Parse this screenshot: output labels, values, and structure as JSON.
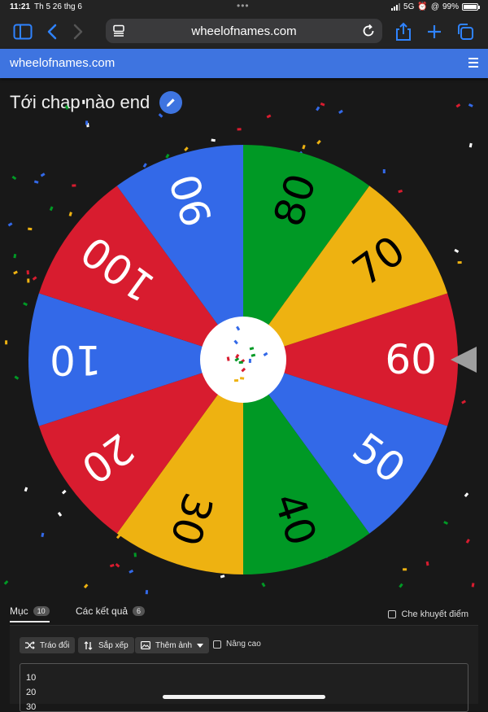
{
  "status_bar": {
    "time": "11:21",
    "date": "Th 5 26 thg 6",
    "network": "5G",
    "battery": "99%"
  },
  "browser": {
    "url": "wheelofnames.com"
  },
  "site": {
    "logo": "wheelofnames.com"
  },
  "wheel": {
    "title": "Tới chap nào end",
    "segments": [
      {
        "label": "60",
        "color": "#d81c2f"
      },
      {
        "label": "50",
        "color": "#3369e8"
      },
      {
        "label": "40",
        "color": "#009925"
      },
      {
        "label": "30",
        "color": "#eeb211"
      },
      {
        "label": "20",
        "color": "#d81c2f"
      },
      {
        "label": "10",
        "color": "#3369e8"
      },
      {
        "label": "100",
        "color": "#d81c2f"
      },
      {
        "label": "90",
        "color": "#3369e8"
      },
      {
        "label": "80",
        "color": "#009925"
      },
      {
        "label": "70",
        "color": "#eeb211"
      }
    ]
  },
  "tabs": {
    "entries_label": "Mục",
    "entries_count": "10",
    "results_label": "Các kết quả",
    "results_count": "6"
  },
  "hide_label": "Che khuyết điểm",
  "controls": {
    "shuffle": "Tráo đổi",
    "sort": "Sắp xếp",
    "add_image": "Thêm ảnh",
    "advanced": "Nâng cao"
  },
  "entries": [
    "10",
    "20",
    "30"
  ],
  "colors": {
    "accent": "#3e74e0",
    "background": "#181818"
  }
}
